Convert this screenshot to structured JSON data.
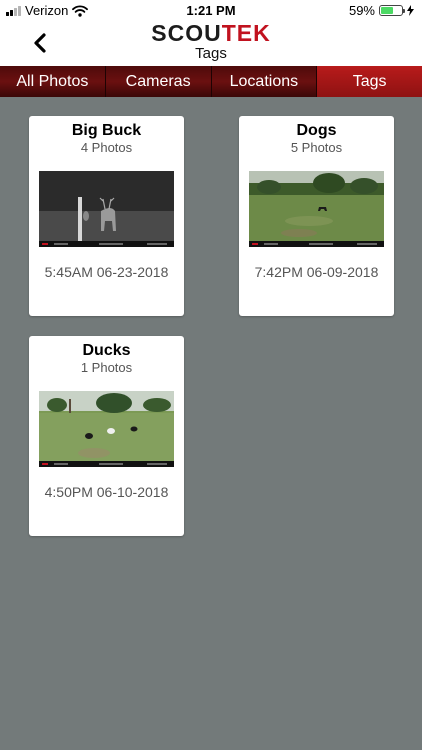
{
  "status_bar": {
    "carrier": "Verizon",
    "time": "1:21 PM",
    "battery_percent": "59%",
    "battery_level": 0.59,
    "icons": [
      "cellular-signal-icon",
      "wifi-icon",
      "battery-icon",
      "charging-bolt-icon"
    ]
  },
  "nav": {
    "logo_part1": "SCOU",
    "logo_part2": "TEK",
    "title": "Tags",
    "back_icon": "chevron-left-icon"
  },
  "tabs": [
    {
      "label": "All Photos",
      "active": false
    },
    {
      "label": "Cameras",
      "active": false
    },
    {
      "label": "Locations",
      "active": false
    },
    {
      "label": "Tags",
      "active": true
    }
  ],
  "tags": [
    {
      "name": "Big Buck",
      "count": "4 Photos",
      "timestamp": "5:45AM 06-23-2018",
      "photo": "night-infrared-deer-photo"
    },
    {
      "name": "Dogs",
      "count": "5 Photos",
      "timestamp": "7:42PM 06-09-2018",
      "photo": "daylight-field-dog-photo"
    },
    {
      "name": "Ducks",
      "count": "1 Photos",
      "timestamp": "4:50PM 06-10-2018",
      "photo": "daylight-field-ducks-photo"
    }
  ],
  "colors": {
    "accent": "#c1121f",
    "tab_bar": "#6b1010",
    "active_tab": "#b81b1b",
    "background": "#737a7a",
    "battery_fill": "#4cd964"
  }
}
